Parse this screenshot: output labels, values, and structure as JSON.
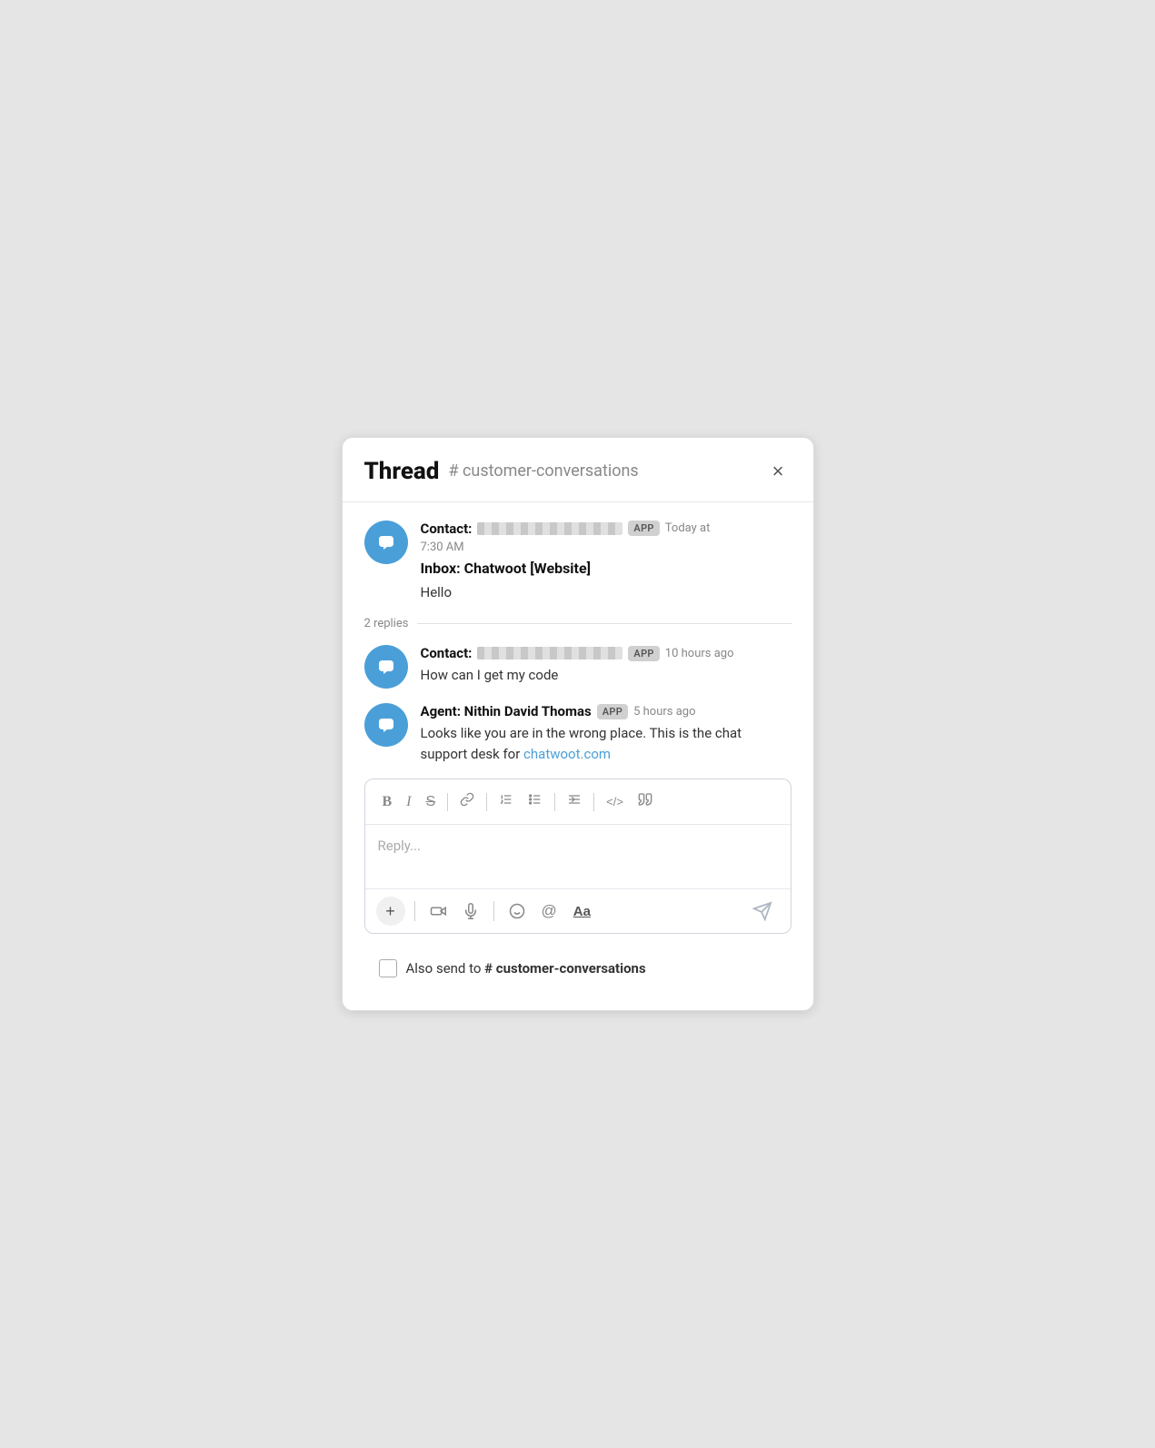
{
  "header": {
    "title": "Thread",
    "channel": "# customer-conversations",
    "close_label": "×"
  },
  "messages": [
    {
      "id": "msg1",
      "sender_prefix": "Contact:",
      "sender_redacted": true,
      "badge": "APP",
      "timestamp_line1": "Today at",
      "timestamp_line2": "7:30 AM",
      "subject": "Inbox: Chatwoot [Website]",
      "text": "Hello",
      "link": null
    }
  ],
  "replies_divider": {
    "label": "2 replies"
  },
  "replies": [
    {
      "id": "reply1",
      "sender_prefix": "Contact:",
      "sender_redacted": true,
      "badge": "APP",
      "timestamp": "10 hours ago",
      "text": "How can I get my code",
      "link": null
    },
    {
      "id": "reply2",
      "sender_prefix": "Agent:",
      "sender_name": "Nithin David Thomas",
      "sender_redacted": false,
      "badge": "APP",
      "timestamp": "5 hours ago",
      "text_before_link": "Looks like you are in the wrong place. This is the chat support desk for ",
      "link_text": "chatwoot.com",
      "link_href": "https://chatwoot.com",
      "text_after_link": ""
    }
  ],
  "reply_box": {
    "placeholder": "Reply...",
    "toolbar": {
      "bold": "B",
      "italic": "I",
      "strikethrough": "S",
      "link": "🔗",
      "ordered_list": "≡",
      "bullet_list": "≡",
      "indent": "≡",
      "code": "</>",
      "quote": "❝"
    },
    "actions": {
      "plus": "+",
      "video": "video",
      "mic": "mic",
      "emoji": "emoji",
      "mention": "@",
      "font": "Aa",
      "send": "send"
    }
  },
  "also_send": {
    "label_static": "Also send to ",
    "channel": "# customer-conversations"
  }
}
